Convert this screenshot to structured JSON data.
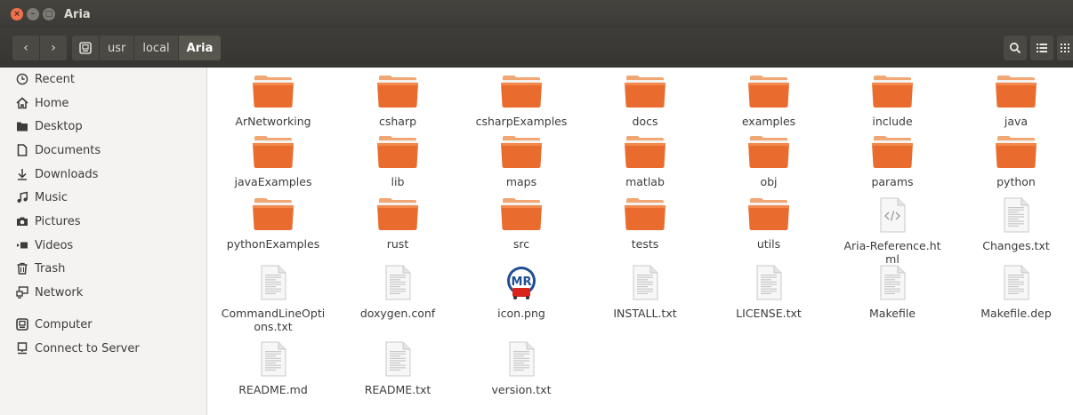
{
  "window": {
    "title": "Aria",
    "close_glyph": "×",
    "min_glyph": "–",
    "max_glyph": "□"
  },
  "toolbar": {
    "back_glyph": "‹",
    "forward_glyph": "›",
    "path": [
      "usr",
      "local",
      "Aria"
    ]
  },
  "sidebar": {
    "items": [
      {
        "label": "Recent",
        "icon": "clock-icon"
      },
      {
        "label": "Home",
        "icon": "home-icon"
      },
      {
        "label": "Desktop",
        "icon": "desktop-folder-icon"
      },
      {
        "label": "Documents",
        "icon": "document-icon"
      },
      {
        "label": "Downloads",
        "icon": "download-icon"
      },
      {
        "label": "Music",
        "icon": "music-icon"
      },
      {
        "label": "Pictures",
        "icon": "camera-icon"
      },
      {
        "label": "Videos",
        "icon": "video-icon"
      },
      {
        "label": "Trash",
        "icon": "trash-icon"
      },
      {
        "label": "Network",
        "icon": "network-icon"
      },
      {
        "label": "Computer",
        "icon": "computer-icon"
      },
      {
        "label": "Connect to Server",
        "icon": "server-icon"
      }
    ]
  },
  "files": [
    {
      "name": "ArNetworking",
      "type": "folder"
    },
    {
      "name": "csharp",
      "type": "folder"
    },
    {
      "name": "csharpExamples",
      "type": "folder"
    },
    {
      "name": "docs",
      "type": "folder"
    },
    {
      "name": "examples",
      "type": "folder"
    },
    {
      "name": "include",
      "type": "folder"
    },
    {
      "name": "java",
      "type": "folder"
    },
    {
      "name": "javaExamples",
      "type": "folder"
    },
    {
      "name": "lib",
      "type": "folder"
    },
    {
      "name": "maps",
      "type": "folder"
    },
    {
      "name": "matlab",
      "type": "folder"
    },
    {
      "name": "obj",
      "type": "folder"
    },
    {
      "name": "params",
      "type": "folder"
    },
    {
      "name": "python",
      "type": "folder"
    },
    {
      "name": "pythonExamples",
      "type": "folder"
    },
    {
      "name": "rust",
      "type": "folder"
    },
    {
      "name": "src",
      "type": "folder"
    },
    {
      "name": "tests",
      "type": "folder"
    },
    {
      "name": "utils",
      "type": "folder"
    },
    {
      "name": "Aria-Reference.html",
      "type": "html"
    },
    {
      "name": "Changes.txt",
      "type": "text"
    },
    {
      "name": "CommandLineOptions.txt",
      "type": "text"
    },
    {
      "name": "doxygen.conf",
      "type": "text"
    },
    {
      "name": "icon.png",
      "type": "png"
    },
    {
      "name": "INSTALL.txt",
      "type": "text"
    },
    {
      "name": "LICENSE.txt",
      "type": "text"
    },
    {
      "name": "Makefile",
      "type": "text"
    },
    {
      "name": "Makefile.dep",
      "type": "text"
    },
    {
      "name": "README.md",
      "type": "text"
    },
    {
      "name": "README.txt",
      "type": "text"
    },
    {
      "name": "version.txt",
      "type": "text"
    }
  ],
  "icon_png_badge": "MR",
  "colors": {
    "folder_top": "#f0a774",
    "folder_body": "#e96c2e",
    "titlebar": "#3b3a36",
    "close_button": "#f0714b"
  }
}
